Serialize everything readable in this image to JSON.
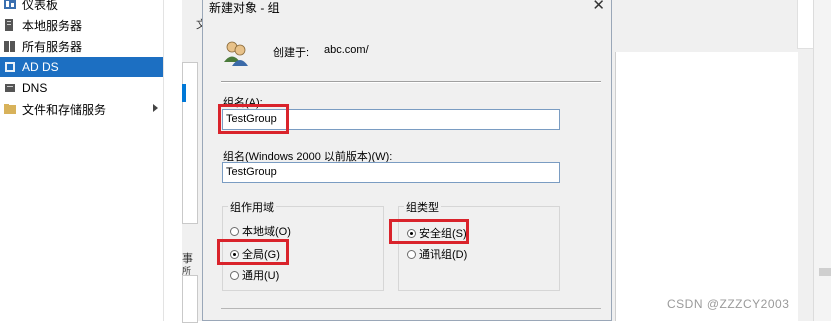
{
  "sidebar": {
    "items": [
      {
        "label": "仪表板",
        "icon": "dashboard-icon"
      },
      {
        "label": "本地服务器",
        "icon": "server-icon"
      },
      {
        "label": "所有服务器",
        "icon": "servers-icon"
      },
      {
        "label": "AD DS",
        "icon": "ad-ds-icon",
        "selected": true
      },
      {
        "label": "DNS",
        "icon": "dns-icon"
      },
      {
        "label": "文件和存储服务",
        "icon": "storage-icon",
        "has_arrow": true
      }
    ]
  },
  "background": {
    "text1": "文",
    "text2": "事",
    "text3": "所"
  },
  "dialog": {
    "title": "新建对象 - 组",
    "close_glyph": "✕",
    "created_in_label": "创建于:",
    "created_in_value": "abc.com/",
    "group_name_label": "组名(A):",
    "group_name_value": "TestGroup",
    "group_name_legacy_label": "组名(Windows 2000 以前版本)(W):",
    "group_name_legacy_value": "TestGroup",
    "scope": {
      "title": "组作用域",
      "options": [
        {
          "label": "本地域(O)",
          "checked": false
        },
        {
          "label": "全局(G)",
          "checked": true
        },
        {
          "label": "通用(U)",
          "checked": false
        }
      ]
    },
    "type": {
      "title": "组类型",
      "options": [
        {
          "label": "安全组(S)",
          "checked": true
        },
        {
          "label": "通讯组(D)",
          "checked": false
        }
      ]
    }
  },
  "watermark": "CSDN @ZZZCY2003",
  "colors": {
    "highlight": "#d9232b",
    "selected_nav": "#1c6fc2"
  }
}
